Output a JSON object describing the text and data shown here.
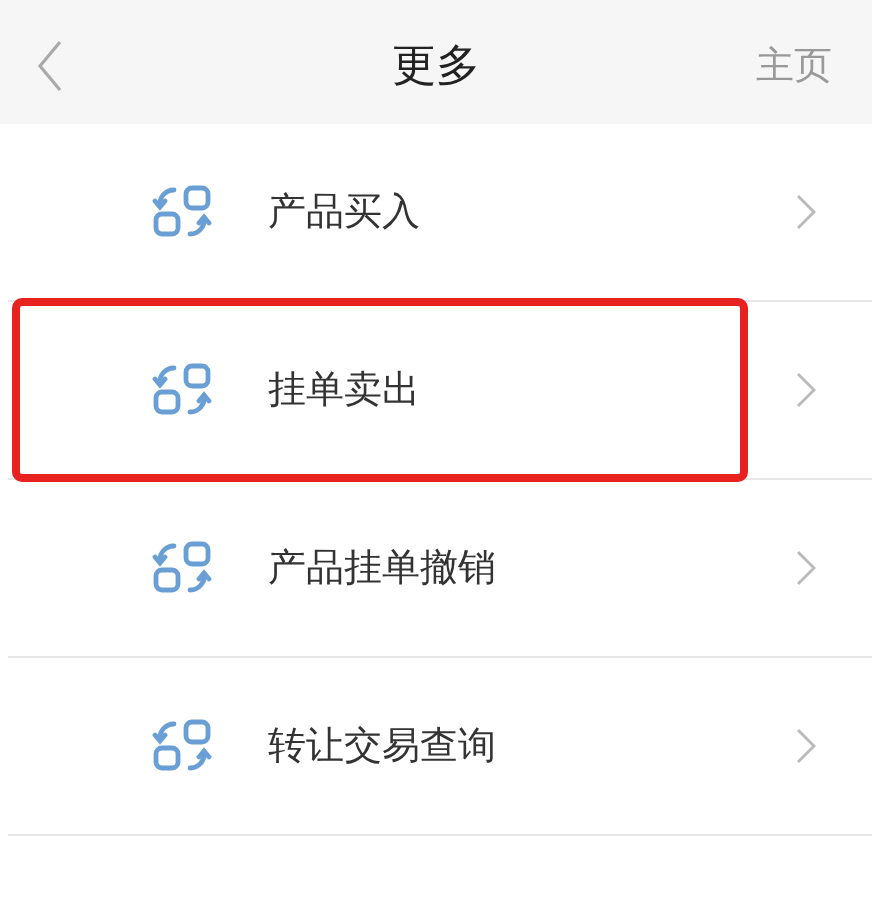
{
  "header": {
    "title": "更多",
    "home_link": "主页"
  },
  "items": [
    {
      "label": "产品买入",
      "highlighted": false
    },
    {
      "label": "挂单卖出",
      "highlighted": true
    },
    {
      "label": "产品挂单撤销",
      "highlighted": false
    },
    {
      "label": "转让交易查询",
      "highlighted": false
    }
  ]
}
